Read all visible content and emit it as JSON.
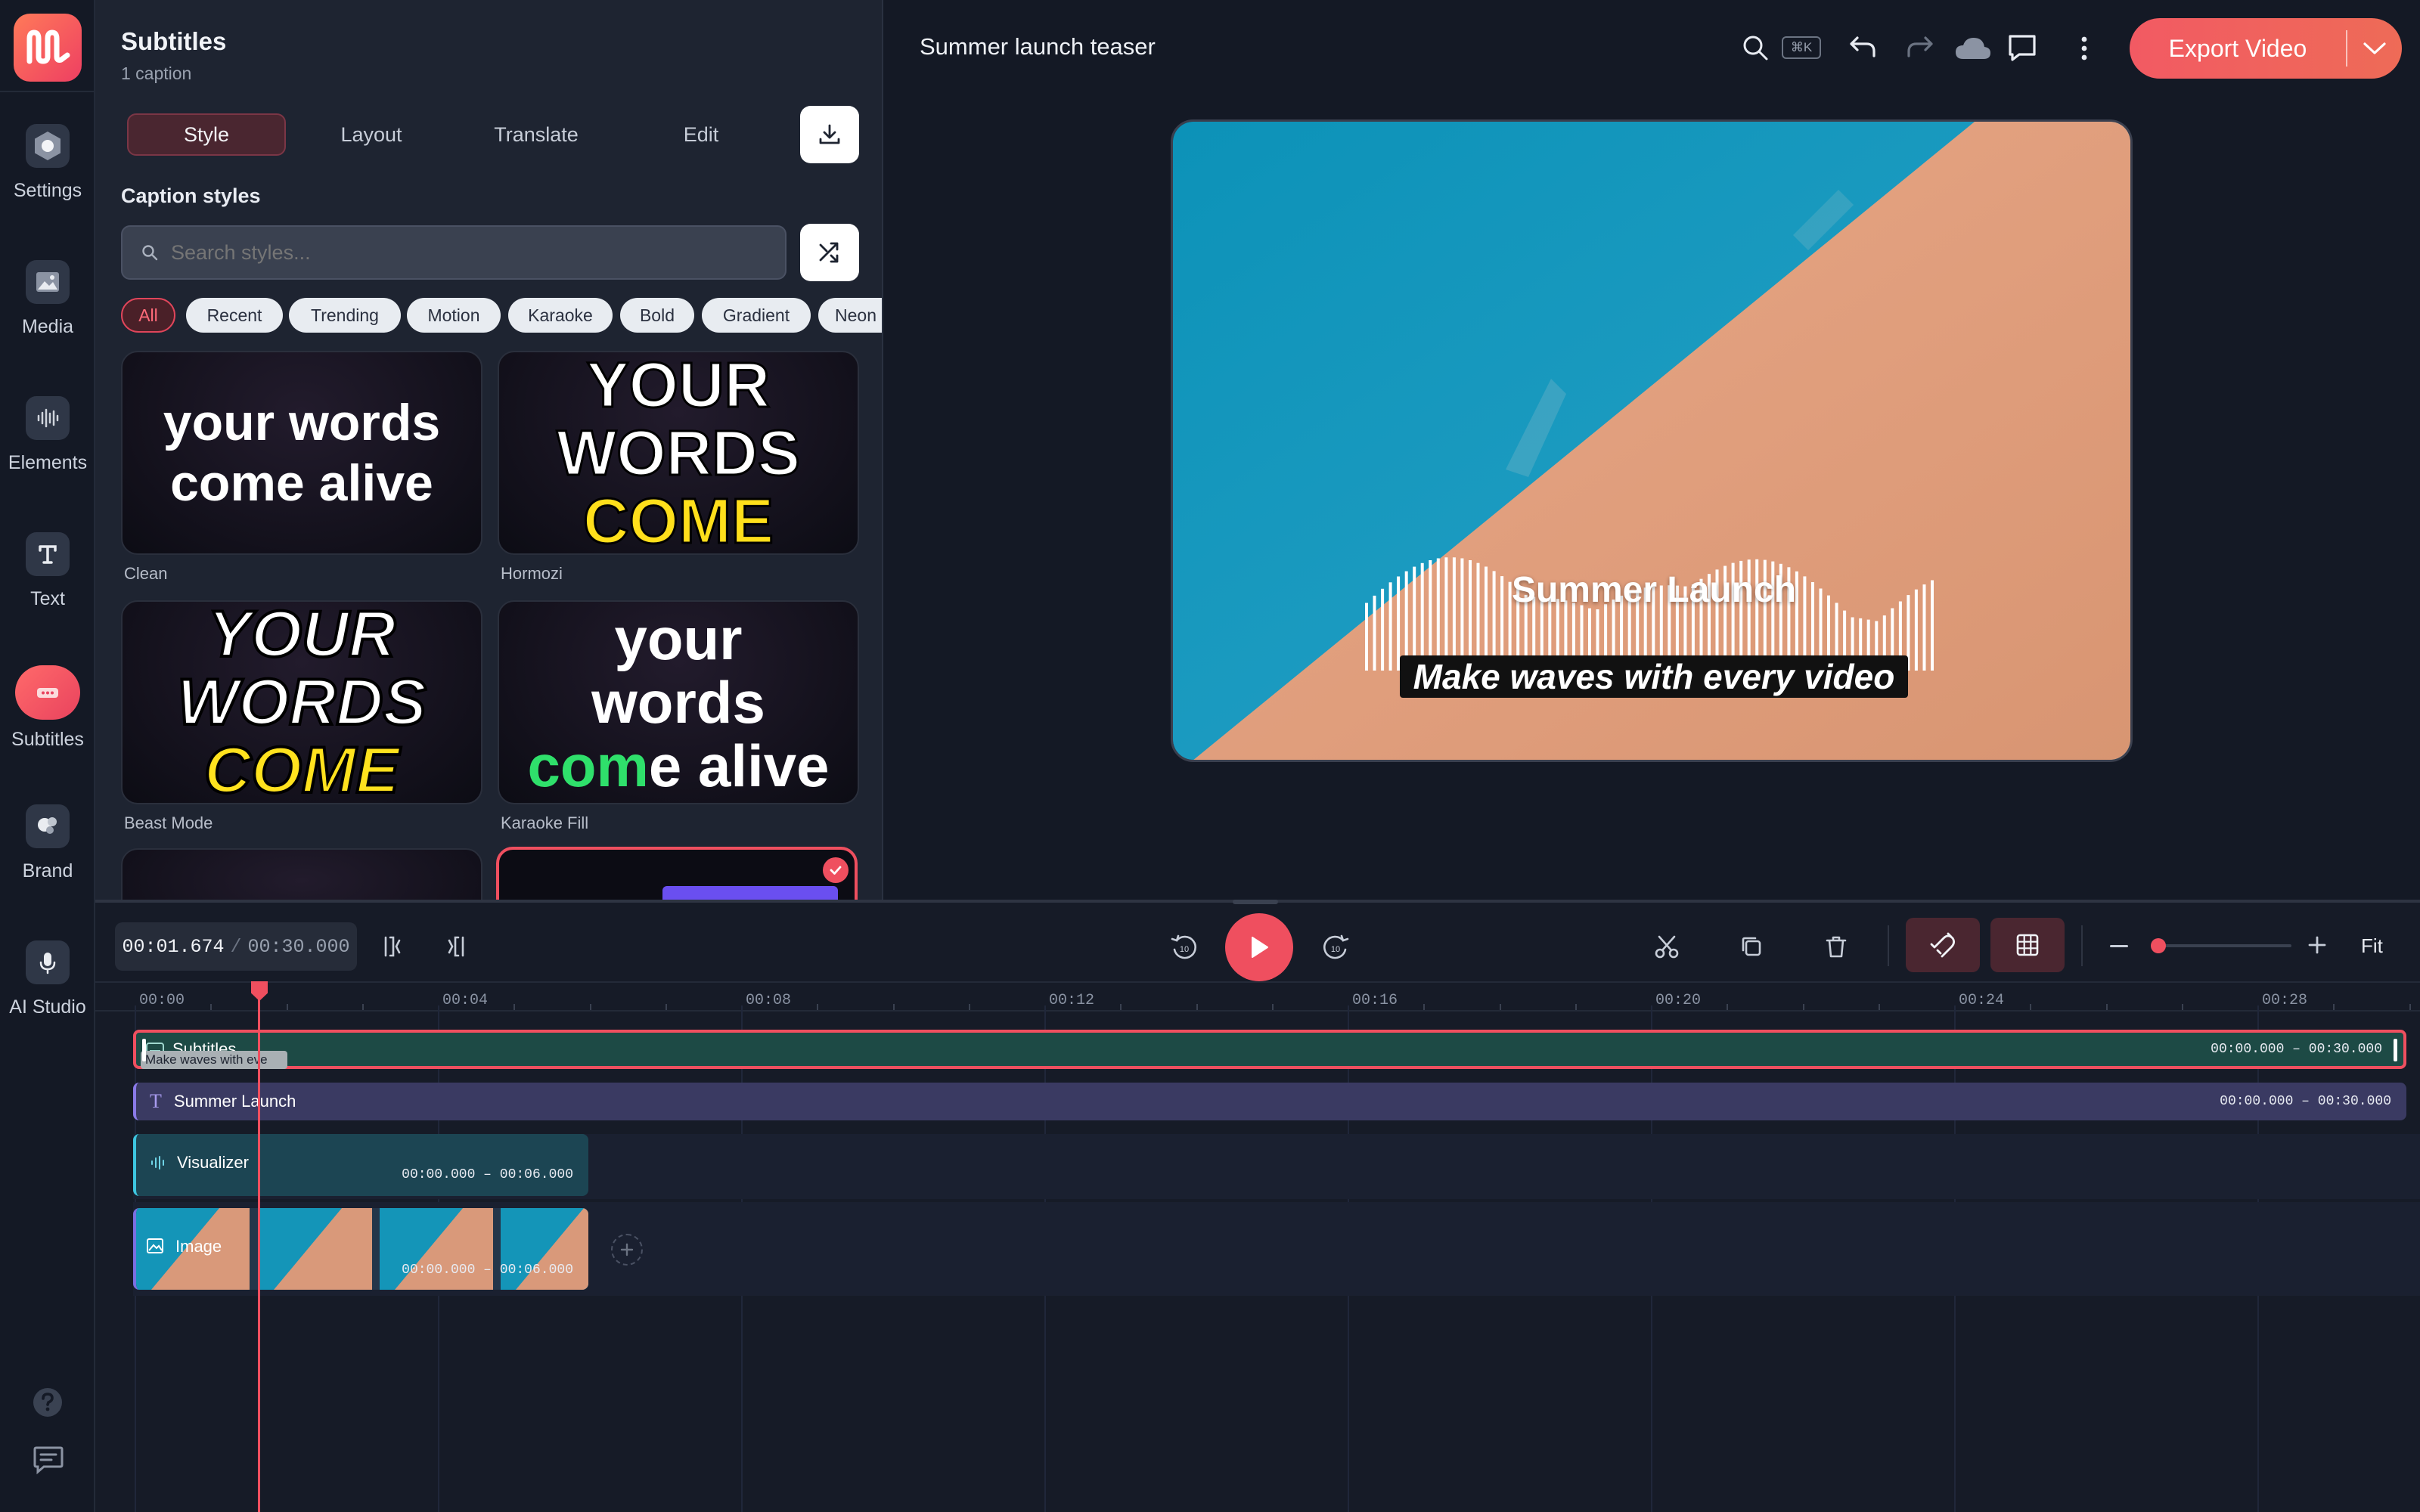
{
  "rail": {
    "items": [
      {
        "label": "Settings",
        "icon": "hexagon-icon"
      },
      {
        "label": "Media",
        "icon": "image-icon"
      },
      {
        "label": "Elements",
        "icon": "waveform-icon"
      },
      {
        "label": "Text",
        "icon": "text-icon"
      },
      {
        "label": "Subtitles",
        "icon": "captions-icon",
        "active": true
      },
      {
        "label": "Brand",
        "icon": "palette-icon"
      },
      {
        "label": "AI Studio",
        "icon": "microphone-icon"
      }
    ]
  },
  "panel": {
    "title": "Subtitles",
    "subtitle": "1 caption",
    "tabs": [
      "Style",
      "Layout",
      "Translate",
      "Edit"
    ],
    "active_tab": "Style",
    "section_title": "Caption styles",
    "search_placeholder": "Search styles...",
    "filters": [
      "All",
      "Recent",
      "Trending",
      "Motion",
      "Karaoke",
      "Bold",
      "Gradient",
      "Neon"
    ],
    "active_filter": "All",
    "styles": [
      {
        "name": "Clean",
        "line1": "your words",
        "line2": "come alive"
      },
      {
        "name": "Hormozi",
        "line1": "YOUR",
        "line2": "WORDS",
        "line3": "COME"
      },
      {
        "name": "Beast Mode",
        "line1": "YOUR",
        "line2": "WORDS",
        "line3": "COME"
      },
      {
        "name": "Karaoke Fill",
        "line1": "your",
        "line2": "words",
        "line3a": "com",
        "line3b": "e alive"
      }
    ]
  },
  "project": {
    "title": "Summer launch teaser",
    "shortcut": "⌘K"
  },
  "export_label": "Export Video",
  "preview": {
    "title_text": "Summer Launch",
    "caption_text": "Make waves with every video"
  },
  "timeline": {
    "current_time": "00:01.674",
    "separator": "/",
    "total_time": "00:30.000",
    "fit_label": "Fit",
    "ticks": [
      "00:00",
      "00:04",
      "00:08",
      "00:12",
      "00:16",
      "00:20",
      "00:24",
      "00:28"
    ],
    "zoom": 0.0,
    "tracks": [
      {
        "name": "Subtitles",
        "range": "00:00.000 – 00:30.000",
        "chip": "Make waves with eve"
      },
      {
        "name": "Summer Launch",
        "range": "00:00.000 – 00:30.000"
      },
      {
        "name": "Visualizer",
        "range": "00:00.000 – 00:06.000"
      },
      {
        "name": "Image",
        "range": "00:00.000 – 00:06.000"
      }
    ]
  },
  "colors": {
    "accent": "#ef4f5f",
    "subtitle_track": "#1d4a45",
    "text_track": "#3a3a62",
    "visualizer_track": "#1c4553"
  }
}
